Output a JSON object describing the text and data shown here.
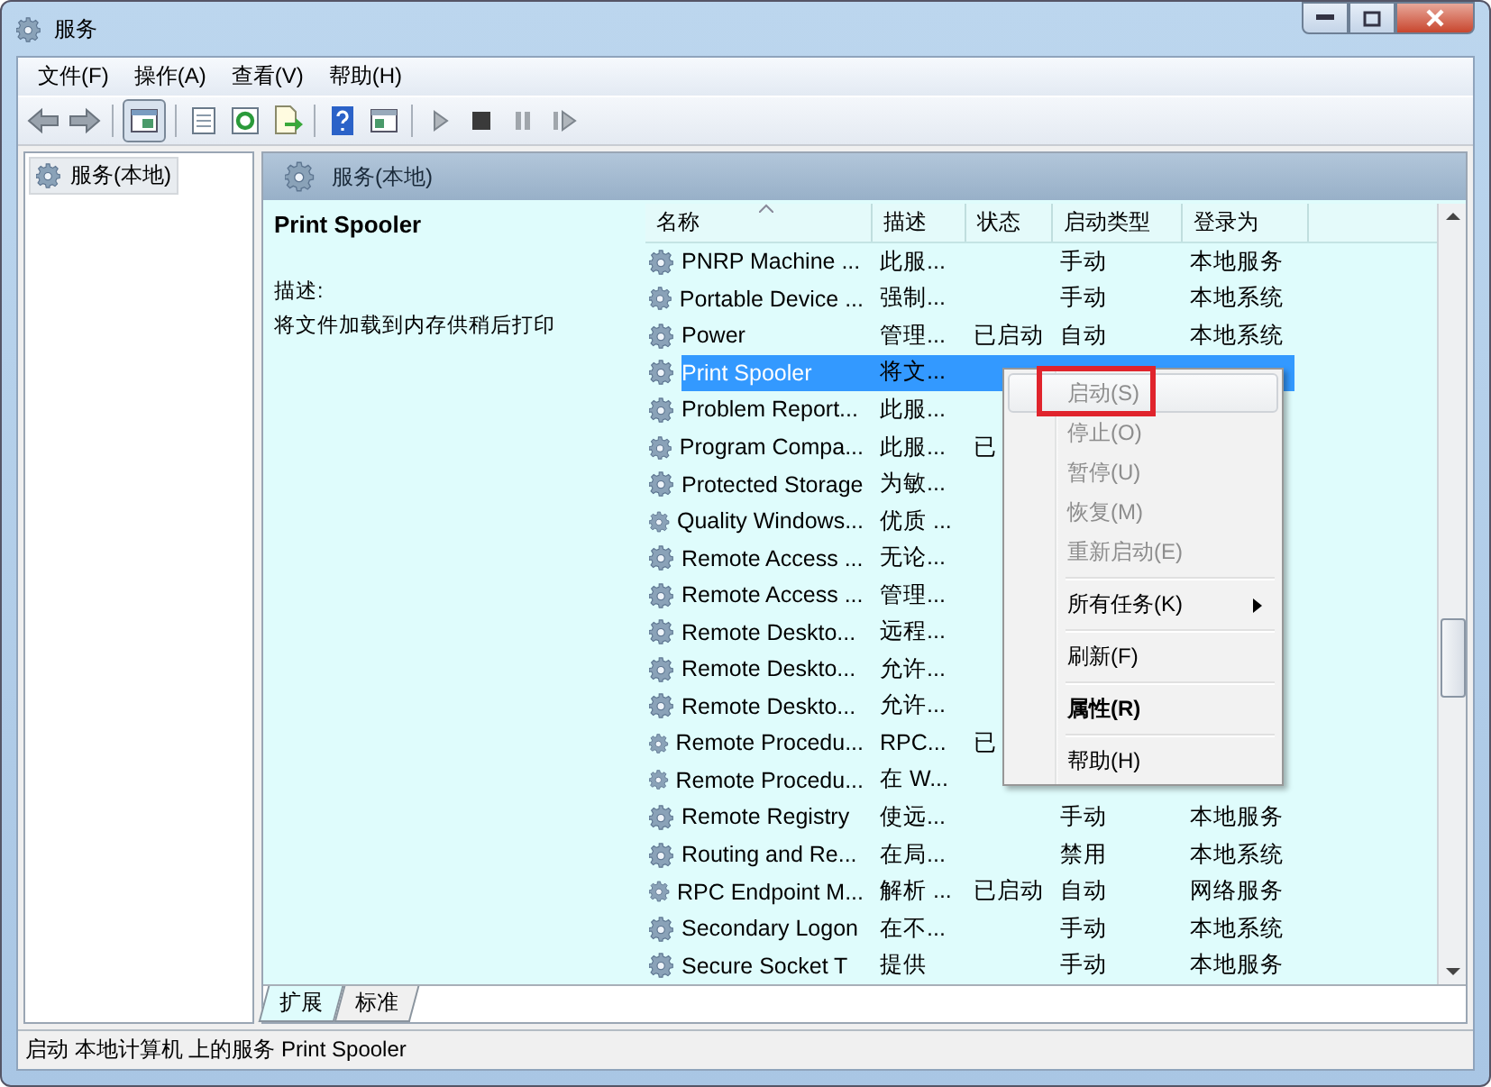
{
  "window": {
    "title": "服务"
  },
  "menu_bar": [
    "文件(F)",
    "操作(A)",
    "查看(V)",
    "帮助(H)"
  ],
  "toolbar": [
    {
      "kind": "back"
    },
    {
      "kind": "forward"
    },
    {
      "kind": "sep"
    },
    {
      "kind": "tree",
      "selected": true
    },
    {
      "kind": "sep"
    },
    {
      "kind": "props"
    },
    {
      "kind": "refresh"
    },
    {
      "kind": "export"
    },
    {
      "kind": "sep"
    },
    {
      "kind": "help"
    },
    {
      "kind": "view"
    },
    {
      "kind": "sep"
    },
    {
      "kind": "play"
    },
    {
      "kind": "stop"
    },
    {
      "kind": "pause"
    },
    {
      "kind": "resume"
    }
  ],
  "tree": {
    "items": [
      {
        "label": "服务(本地)",
        "selected": true
      }
    ]
  },
  "pane": {
    "title": "服务(本地)",
    "detail": {
      "service_name": "Print Spooler",
      "description_label": "描述:",
      "description": "将文件加载到内存供稍后打印"
    },
    "columns": [
      {
        "label": "名称",
        "sorted": true
      },
      {
        "label": "描述",
        "sorted": false
      },
      {
        "label": "状态",
        "sorted": false
      },
      {
        "label": "启动类型",
        "sorted": false
      },
      {
        "label": "登录为",
        "sorted": false
      }
    ],
    "rows": [
      {
        "name": "PNRP Machine ...",
        "desc": "此服...",
        "status": "",
        "startup": "手动",
        "logon": "本地服务",
        "selected": false
      },
      {
        "name": "Portable Device ...",
        "desc": "强制...",
        "status": "",
        "startup": "手动",
        "logon": "本地系统",
        "selected": false
      },
      {
        "name": "Power",
        "desc": "管理...",
        "status": "已启动",
        "startup": "自动",
        "logon": "本地系统",
        "selected": false
      },
      {
        "name": "Print Spooler",
        "desc": "将文...",
        "status": "",
        "startup": "",
        "logon": "",
        "selected": true
      },
      {
        "name": "Problem Report...",
        "desc": "此服...",
        "status": "",
        "startup": "",
        "logon": "",
        "selected": false
      },
      {
        "name": "Program Compa...",
        "desc": "此服...",
        "status": "已",
        "startup": "",
        "logon": "",
        "selected": false
      },
      {
        "name": "Protected Storage",
        "desc": "为敏...",
        "status": "",
        "startup": "",
        "logon": "",
        "selected": false
      },
      {
        "name": "Quality Windows...",
        "desc": "优质 ...",
        "status": "",
        "startup": "",
        "logon": "",
        "selected": false
      },
      {
        "name": "Remote Access ...",
        "desc": "无论...",
        "status": "",
        "startup": "",
        "logon": "",
        "selected": false
      },
      {
        "name": "Remote Access ...",
        "desc": "管理...",
        "status": "",
        "startup": "",
        "logon": "",
        "selected": false
      },
      {
        "name": "Remote Deskto...",
        "desc": "远程...",
        "status": "",
        "startup": "",
        "logon": "",
        "selected": false
      },
      {
        "name": "Remote Deskto...",
        "desc": "允许...",
        "status": "",
        "startup": "",
        "logon": "",
        "selected": false
      },
      {
        "name": "Remote Deskto...",
        "desc": "允许...",
        "status": "",
        "startup": "",
        "logon": "",
        "selected": false
      },
      {
        "name": "Remote Procedu...",
        "desc": "RPC...",
        "status": "已",
        "startup": "",
        "logon": "",
        "selected": false
      },
      {
        "name": "Remote Procedu...",
        "desc": "在 W...",
        "status": "",
        "startup": "",
        "logon": "",
        "selected": false
      },
      {
        "name": "Remote Registry",
        "desc": "使远...",
        "status": "",
        "startup": "手动",
        "logon": "本地服务",
        "selected": false
      },
      {
        "name": "Routing and Re...",
        "desc": "在局...",
        "status": "",
        "startup": "禁用",
        "logon": "本地系统",
        "selected": false
      },
      {
        "name": "RPC Endpoint M...",
        "desc": "解析 ...",
        "status": "已启动",
        "startup": "自动",
        "logon": "网络服务",
        "selected": false
      },
      {
        "name": "Secondary Logon",
        "desc": "在不...",
        "status": "",
        "startup": "手动",
        "logon": "本地系统",
        "selected": false
      },
      {
        "name": "Secure Socket T",
        "desc": "提供",
        "status": "",
        "startup": "手动",
        "logon": "本地服务",
        "selected": false
      }
    ],
    "tabs": [
      {
        "label": "扩展",
        "selected": true
      },
      {
        "label": "标准",
        "selected": false
      }
    ]
  },
  "context_menu": [
    {
      "label": "启动(S)",
      "disabled": true,
      "highlighted": true,
      "marked": true
    },
    {
      "label": "停止(O)",
      "disabled": true,
      "highlighted": false,
      "marked": false
    },
    {
      "label": "暂停(U)",
      "disabled": true,
      "highlighted": false,
      "marked": false
    },
    {
      "label": "恢复(M)",
      "disabled": true,
      "highlighted": false,
      "marked": false
    },
    {
      "label": "重新启动(E)",
      "disabled": true,
      "highlighted": false,
      "marked": false
    },
    {
      "label": "所有任务(K)",
      "disabled": false,
      "highlighted": false,
      "marked": false,
      "separator_before": true,
      "submenu": true
    },
    {
      "label": "刷新(F)",
      "disabled": false,
      "highlighted": false,
      "marked": false,
      "separator_before": true
    },
    {
      "label": "属性(R)",
      "disabled": false,
      "highlighted": false,
      "marked": false,
      "separator_before": true,
      "default": true
    },
    {
      "label": "帮助(H)",
      "disabled": false,
      "highlighted": false,
      "marked": false,
      "separator_before": true
    }
  ],
  "status_bar": "启动 本地计算机 上的服务 Print Spooler"
}
